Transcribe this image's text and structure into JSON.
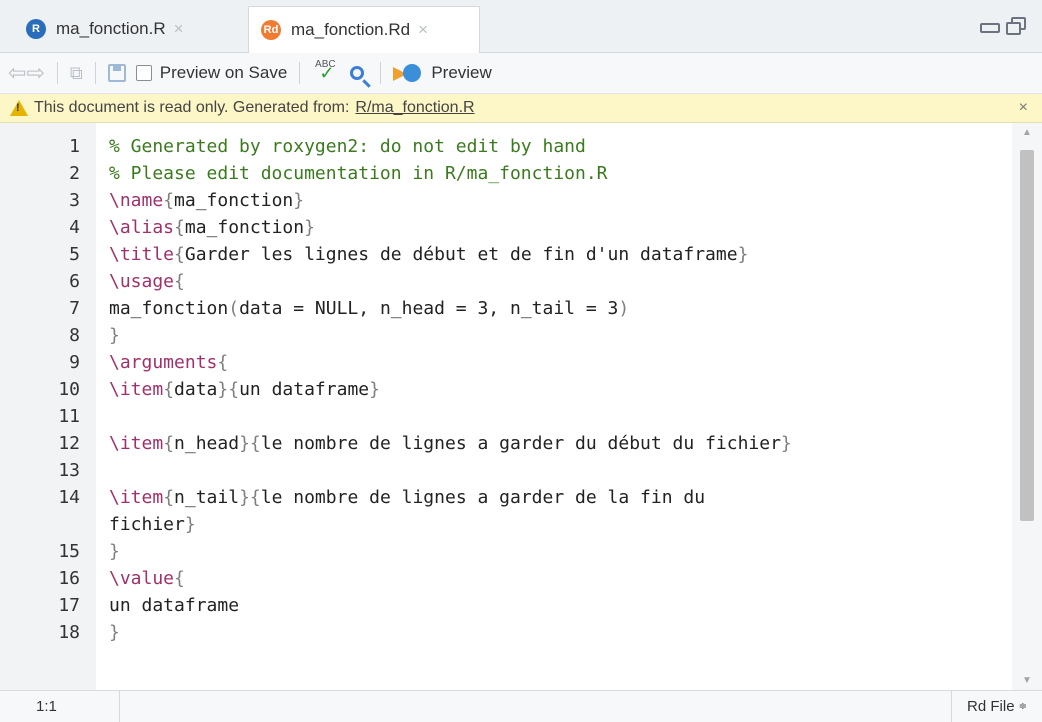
{
  "tabs": [
    {
      "label": "ma_fonction.R",
      "icon": "r-file-icon",
      "icon_text": "R"
    },
    {
      "label": "ma_fonction.Rd",
      "icon": "rd-file-icon",
      "icon_text": "Rd"
    }
  ],
  "tab_close_glyph": "×",
  "toolbar": {
    "preview_on_save_label": "Preview on Save",
    "spell_abc": "ABC",
    "preview_label": "Preview"
  },
  "infobar": {
    "message": "This document is read only. Generated from:",
    "link": "R/ma_fonction.R",
    "close_glyph": "×"
  },
  "code_lines": [
    {
      "n": "1",
      "segs": [
        {
          "c": "cm",
          "t": "% Generated by roxygen2: do not edit by hand"
        }
      ]
    },
    {
      "n": "2",
      "segs": [
        {
          "c": "cm",
          "t": "% Please edit documentation in R/ma_fonction.R"
        }
      ]
    },
    {
      "n": "3",
      "segs": [
        {
          "c": "kw",
          "t": "\\name"
        },
        {
          "c": "br",
          "t": "{"
        },
        {
          "c": "",
          "t": "ma_fonction"
        },
        {
          "c": "br",
          "t": "}"
        }
      ]
    },
    {
      "n": "4",
      "segs": [
        {
          "c": "kw",
          "t": "\\alias"
        },
        {
          "c": "br",
          "t": "{"
        },
        {
          "c": "",
          "t": "ma_fonction"
        },
        {
          "c": "br",
          "t": "}"
        }
      ]
    },
    {
      "n": "5",
      "segs": [
        {
          "c": "kw",
          "t": "\\title"
        },
        {
          "c": "br",
          "t": "{"
        },
        {
          "c": "",
          "t": "Garder les lignes de début et de fin d'un dataframe"
        },
        {
          "c": "br",
          "t": "}"
        }
      ]
    },
    {
      "n": "6",
      "segs": [
        {
          "c": "kw",
          "t": "\\usage"
        },
        {
          "c": "br",
          "t": "{"
        }
      ]
    },
    {
      "n": "7",
      "segs": [
        {
          "c": "",
          "t": "ma_fonction"
        },
        {
          "c": "br",
          "t": "("
        },
        {
          "c": "",
          "t": "data = NULL, n_head = 3, n_tail = 3"
        },
        {
          "c": "br",
          "t": ")"
        }
      ]
    },
    {
      "n": "8",
      "segs": [
        {
          "c": "br",
          "t": "}"
        }
      ]
    },
    {
      "n": "9",
      "segs": [
        {
          "c": "kw",
          "t": "\\arguments"
        },
        {
          "c": "br",
          "t": "{"
        }
      ]
    },
    {
      "n": "10",
      "segs": [
        {
          "c": "kw",
          "t": "\\item"
        },
        {
          "c": "br",
          "t": "{"
        },
        {
          "c": "",
          "t": "data"
        },
        {
          "c": "br",
          "t": "}{"
        },
        {
          "c": "",
          "t": "un dataframe"
        },
        {
          "c": "br",
          "t": "}"
        }
      ]
    },
    {
      "n": "11",
      "segs": []
    },
    {
      "n": "12",
      "segs": [
        {
          "c": "kw",
          "t": "\\item"
        },
        {
          "c": "br",
          "t": "{"
        },
        {
          "c": "",
          "t": "n_head"
        },
        {
          "c": "br",
          "t": "}{"
        },
        {
          "c": "",
          "t": "le nombre de lignes a garder du début du fichier"
        },
        {
          "c": "br",
          "t": "}"
        }
      ]
    },
    {
      "n": "13",
      "segs": []
    },
    {
      "n": "14",
      "segs": [
        {
          "c": "kw",
          "t": "\\item"
        },
        {
          "c": "br",
          "t": "{"
        },
        {
          "c": "",
          "t": "n_tail"
        },
        {
          "c": "br",
          "t": "}{"
        },
        {
          "c": "",
          "t": "le nombre de lignes a garder de la fin du"
        }
      ]
    },
    {
      "n": "",
      "segs": [
        {
          "c": "",
          "t": "fichier"
        },
        {
          "c": "br",
          "t": "}"
        }
      ]
    },
    {
      "n": "15",
      "segs": [
        {
          "c": "br",
          "t": "}"
        }
      ]
    },
    {
      "n": "16",
      "segs": [
        {
          "c": "kw",
          "t": "\\value"
        },
        {
          "c": "br",
          "t": "{"
        }
      ]
    },
    {
      "n": "17",
      "segs": [
        {
          "c": "",
          "t": "un dataframe"
        }
      ]
    },
    {
      "n": "18",
      "segs": [
        {
          "c": "br",
          "t": "}"
        }
      ]
    }
  ],
  "statusbar": {
    "position": "1:1",
    "file_type": "Rd File",
    "file_type_glyph": "≑"
  },
  "colors": {
    "comment": "#3b7a1f",
    "keyword": "#a0306b",
    "brace": "#7f7f7f",
    "infobar_bg": "#fdf6c6"
  }
}
